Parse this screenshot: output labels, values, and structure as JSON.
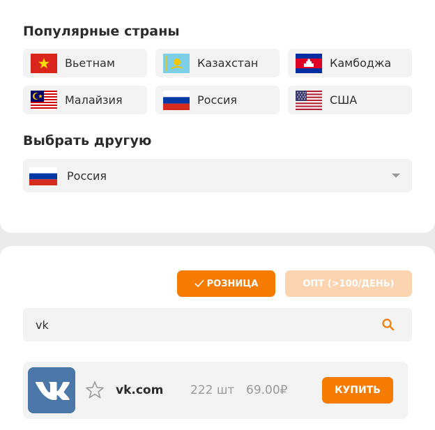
{
  "popular": {
    "title": "Популярные страны",
    "countries": [
      {
        "name": "Вьетнам",
        "flag": "vietnam-flag-icon"
      },
      {
        "name": "Казахстан",
        "flag": "kazakhstan-flag-icon"
      },
      {
        "name": "Камбоджа",
        "flag": "cambodia-flag-icon"
      },
      {
        "name": "Малайзия",
        "flag": "malaysia-flag-icon"
      },
      {
        "name": "Россия",
        "flag": "russia-flag-icon"
      },
      {
        "name": "США",
        "flag": "usa-flag-icon"
      }
    ]
  },
  "choose": {
    "title": "Выбрать другую",
    "selected": "Россия",
    "selected_flag": "russia-flag-icon"
  },
  "mode": {
    "retail_label": "РОЗНИЦА",
    "wholesale_label": "ОПТ (>100/ДЕНЬ)",
    "active": "retail"
  },
  "search": {
    "value": "vk",
    "icon": "search-icon"
  },
  "result": {
    "logo": "vk-logo",
    "name": "vk.com",
    "quantity": "222 шт",
    "price": "69.00₽",
    "buy_label": "КУПИТЬ",
    "favorite_icon": "star-outline-icon"
  },
  "colors": {
    "accent": "#f57c00",
    "accent_light": "#fcd4b0",
    "vk_blue": "#4a76a8"
  }
}
